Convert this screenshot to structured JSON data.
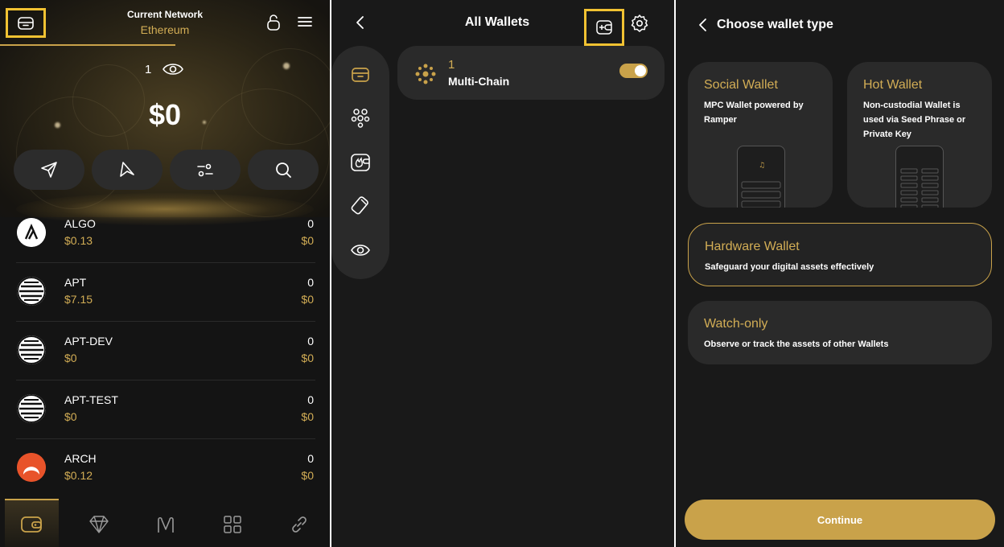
{
  "wallet_panel": {
    "network_label": "Current Network",
    "network_value": "Ethereum",
    "wallet_count": "1",
    "balance": "$0",
    "actions": [
      {
        "icon": "send-icon"
      },
      {
        "icon": "receive-icon"
      },
      {
        "icon": "filter-icon"
      },
      {
        "icon": "search-icon"
      }
    ],
    "tokens": [
      {
        "symbol": "ALGO",
        "price": "$0.13",
        "amount": "0",
        "value": "$0"
      },
      {
        "symbol": "APT",
        "price": "$7.15",
        "amount": "0",
        "value": "$0"
      },
      {
        "symbol": "APT-DEV",
        "price": "$0",
        "amount": "0",
        "value": "$0"
      },
      {
        "symbol": "APT-TEST",
        "price": "$0",
        "amount": "0",
        "value": "$0"
      },
      {
        "symbol": "ARCH",
        "price": "$0.12",
        "amount": "0",
        "value": "$0"
      }
    ],
    "bottom_nav": [
      "wallet-icon",
      "diamond-icon",
      "bridge-icon",
      "apps-grid-icon",
      "link-icon"
    ]
  },
  "all_wallets_panel": {
    "title": "All Wallets",
    "wallets": [
      {
        "name": "1",
        "type": "Multi-Chain",
        "enabled": true
      }
    ],
    "side_rail": [
      "wallet-icon",
      "social-group-icon",
      "hot-wallet-icon",
      "hardware-wallet-icon",
      "eye-icon"
    ]
  },
  "wallet_type_panel": {
    "title": "Choose wallet type",
    "options": [
      {
        "title": "Social Wallet",
        "description": "MPC Wallet powered by Ramper"
      },
      {
        "title": "Hot Wallet",
        "description": "Non-custodial Wallet is used via Seed Phrase or Private Key"
      },
      {
        "title": "Hardware Wallet",
        "description": "Safeguard your digital assets effectively"
      },
      {
        "title": "Watch-only",
        "description": "Observe or track the assets of other Wallets"
      }
    ],
    "continue_label": "Continue"
  },
  "colors": {
    "accent": "#c9a24a",
    "accent_text": "#d2ad55",
    "highlight": "#f1c232",
    "background": "#141414",
    "surface": "#2a2a2a"
  }
}
